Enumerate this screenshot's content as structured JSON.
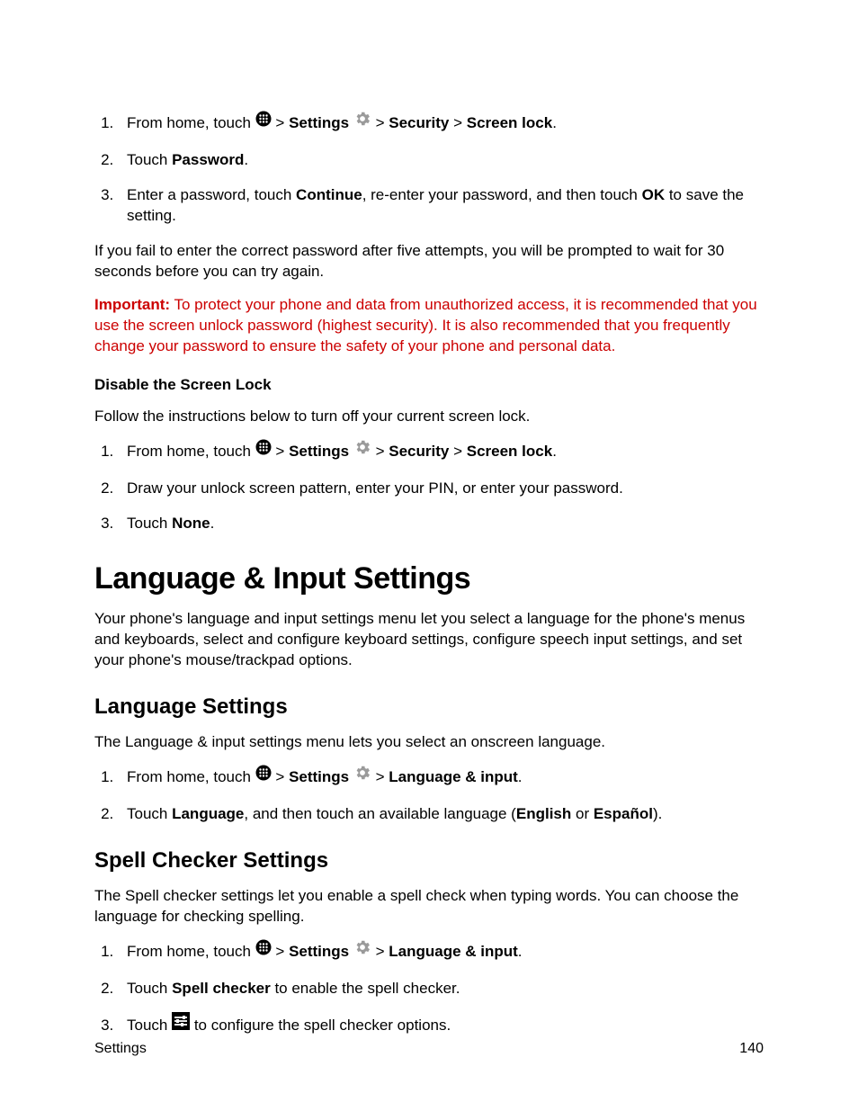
{
  "list1": {
    "item1": {
      "prefix": "From home, touch ",
      "settings": "Settings",
      "security": "Security",
      "screenlock": "Screen lock"
    },
    "item2": {
      "prefix": "Touch ",
      "password": "Password",
      "suffix": "."
    },
    "item3": {
      "a": "Enter a password, touch ",
      "continue": "Continue",
      "b": ", re-enter your password, and then touch ",
      "ok": "OK",
      "c": " to save the setting."
    }
  },
  "para_fail": "If you fail to enter the correct password after five attempts, you will be prompted to wait for 30 seconds before you can try again.",
  "important_label": "Important:",
  "important_text": " To protect your phone and data from unauthorized access, it is recommended that you use the screen unlock password (highest security). It is also recommended that you frequently change your password to ensure the safety of your phone and personal data.",
  "disable_heading": "Disable the Screen Lock",
  "disable_intro": "Follow the instructions below to turn off your current screen lock.",
  "list2": {
    "item1": {
      "prefix": "From home, touch ",
      "settings": "Settings",
      "security": "Security",
      "screenlock": "Screen lock"
    },
    "item2": "Draw your unlock screen pattern, enter your PIN, or enter your password.",
    "item3": {
      "prefix": "Touch ",
      "none": "None",
      "suffix": "."
    }
  },
  "h1_lang": "Language & Input Settings",
  "lang_intro": "Your phone's language and input settings menu let you select a language for the phone's menus and keyboards, select and configure keyboard settings, configure speech input settings, and set your phone's mouse/trackpad options.",
  "h2_langset": "Language Settings",
  "langset_intro": "The Language & input settings menu lets you select an onscreen language.",
  "list3": {
    "item1": {
      "prefix": "From home, touch ",
      "settings": "Settings",
      "langinput": "Language & input"
    },
    "item2": {
      "a": "Touch ",
      "language": "Language",
      "b": ", and then touch an available language (",
      "english": "English",
      "c": " or ",
      "espanol": "Español",
      "d": ")."
    }
  },
  "h2_spell": "Spell Checker Settings",
  "spell_intro": "The Spell checker settings let you enable a spell check when typing words. You can choose the language for checking spelling.",
  "list4": {
    "item1": {
      "prefix": "From home, touch ",
      "settings": "Settings",
      "langinput": "Language & input"
    },
    "item2": {
      "a": "Touch ",
      "spell": "Spell checker",
      "b": " to enable the spell checker."
    },
    "item3": {
      "a": "Touch ",
      "b": " to configure the spell checker options."
    }
  },
  "footer_left": "Settings",
  "footer_right": "140"
}
